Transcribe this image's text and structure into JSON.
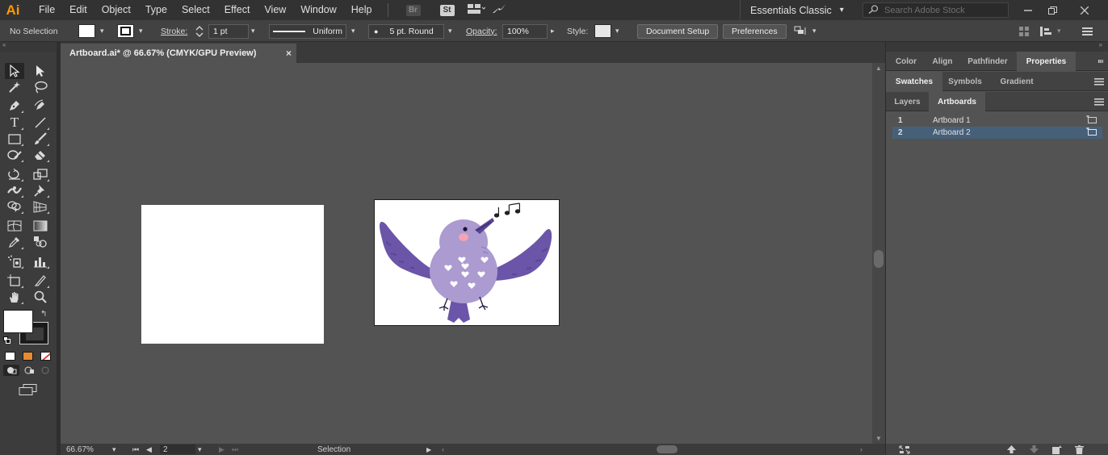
{
  "app": {
    "logo": "Ai",
    "menu": [
      "File",
      "Edit",
      "Object",
      "Type",
      "Select",
      "Effect",
      "View",
      "Window",
      "Help"
    ],
    "badges": {
      "bridge": "Br",
      "stock": "St"
    },
    "workspace": "Essentials Classic",
    "search_placeholder": "Search Adobe Stock"
  },
  "control_bar": {
    "selection": "No Selection",
    "stroke_label": "Stroke:",
    "stroke_weight": "1 pt",
    "stroke_profile": "Uniform",
    "brush": "5 pt. Round",
    "opacity_label": "Opacity:",
    "opacity_value": "100%",
    "style_label": "Style:",
    "document_setup": "Document Setup",
    "preferences": "Preferences"
  },
  "document": {
    "tab_title": "Artboard.ai* @ 66.67% (CMYK/GPU Preview)",
    "close": "×"
  },
  "status_bar": {
    "zoom": "66.67%",
    "artboard_number": "2",
    "tool_name": "Selection"
  },
  "panels": {
    "group1": {
      "tabs": [
        "Color",
        "Align",
        "Pathfinder",
        "Properties"
      ],
      "active": "Properties"
    },
    "group2": {
      "tabs": [
        "Swatches",
        "Symbols",
        "Gradient"
      ],
      "active": "Swatches"
    },
    "group3": {
      "tabs": [
        "Layers",
        "Artboards"
      ],
      "active": "Artboards"
    },
    "artboards": [
      {
        "number": "1",
        "name": "Artboard 1",
        "selected": false
      },
      {
        "number": "2",
        "name": "Artboard 2",
        "selected": true
      }
    ]
  },
  "colors": {
    "accent": "#ff9a00",
    "selection_row": "#46607a",
    "bird_body": "#ab9bd0",
    "bird_wing": "#6b55a8"
  }
}
